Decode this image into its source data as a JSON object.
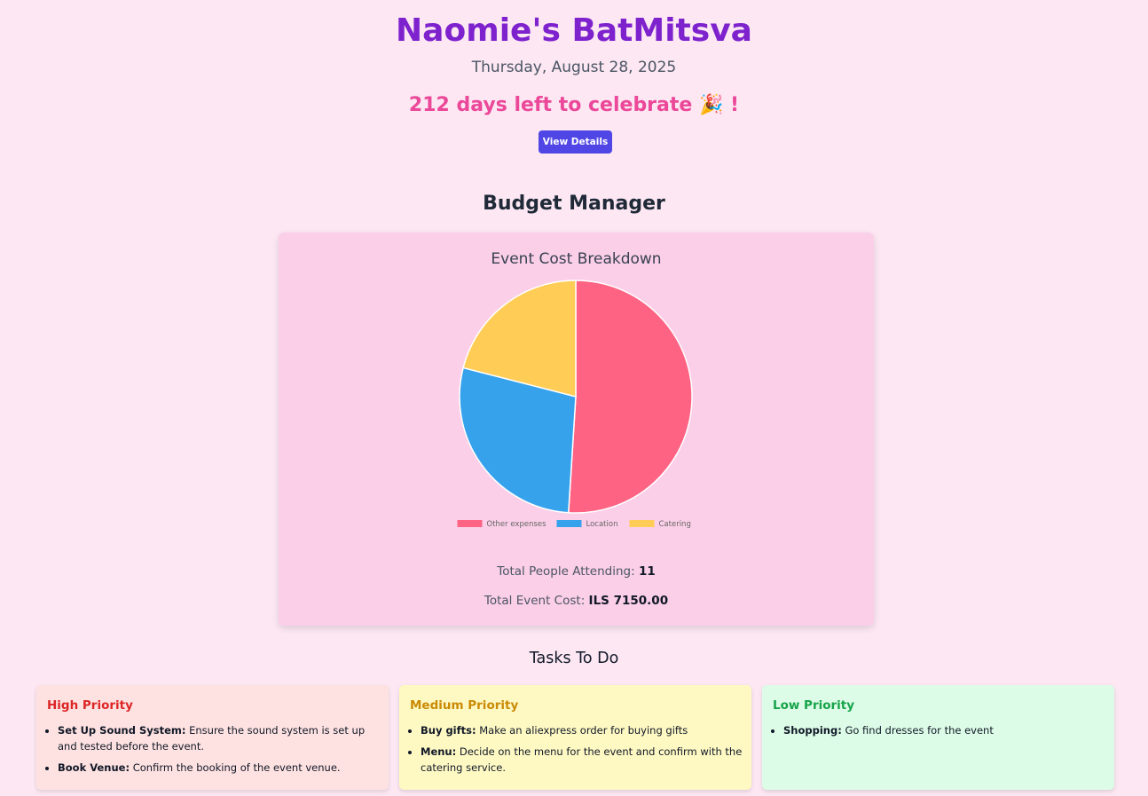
{
  "header": {
    "title": "Naomie's BatMitsva",
    "date": "Thursday, August 28, 2025",
    "countdown": "212 days left to celebrate 🎉 !",
    "details_button": "View Details"
  },
  "budget": {
    "section_title": "Budget Manager",
    "people_label": "Total People Attending:",
    "people_value": "11",
    "cost_label": "Total Event Cost:",
    "cost_value": "ILS 7150.00"
  },
  "chart_data": {
    "type": "pie",
    "title": "Event Cost Breakdown",
    "categories": [
      "Other expenses",
      "Location",
      "Catering"
    ],
    "values": [
      51,
      28,
      21
    ],
    "colors": [
      "#ff6384",
      "#36a2eb",
      "#ffcd56"
    ],
    "legend_position": "bottom"
  },
  "tasks": {
    "section_title": "Tasks To Do",
    "high": {
      "title": "High Priority",
      "items": [
        {
          "name": "Set Up Sound System:",
          "desc": "Ensure the sound system is set up and tested before the event."
        },
        {
          "name": "Book Venue:",
          "desc": "Confirm the booking of the event venue."
        }
      ]
    },
    "medium": {
      "title": "Medium Priority",
      "items": [
        {
          "name": "Buy gifts:",
          "desc": "Make an aliexpress order for buying gifts"
        },
        {
          "name": "Menu:",
          "desc": "Decide on the menu for the event and confirm with the catering service."
        }
      ]
    },
    "low": {
      "title": "Low Priority",
      "items": [
        {
          "name": "Shopping:",
          "desc": "Go find dresses for the event"
        }
      ]
    }
  }
}
